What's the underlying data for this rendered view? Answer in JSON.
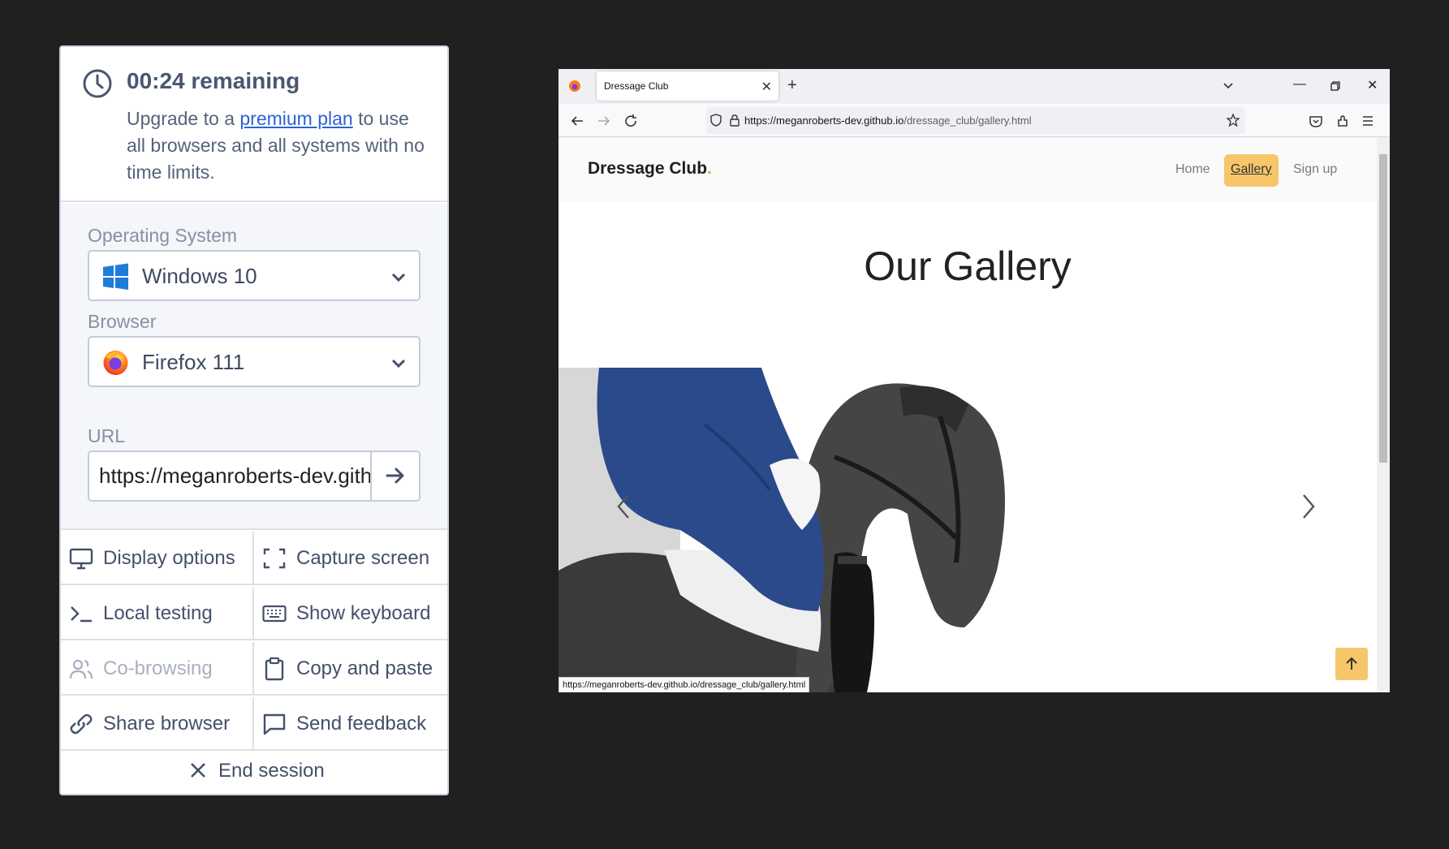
{
  "panel": {
    "timer": {
      "time": "00:24 remaining",
      "upgrade_prefix": "Upgrade to a ",
      "upgrade_link": "premium plan",
      "upgrade_suffix": " to use all browsers and all systems with no time limits."
    },
    "os": {
      "label": "Operating System",
      "value": "Windows 10",
      "icon": "windows-logo-icon"
    },
    "browser": {
      "label": "Browser",
      "value": "Firefox 111",
      "icon": "firefox-logo-icon"
    },
    "url": {
      "label": "URL",
      "value": "https://meganroberts-dev.github.io/dressage_club/gallery.html"
    },
    "actions": [
      {
        "label": "Display options",
        "icon": "monitor-icon",
        "enabled": true
      },
      {
        "label": "Capture screen",
        "icon": "capture-icon",
        "enabled": true
      },
      {
        "label": "Local testing",
        "icon": "terminal-icon",
        "enabled": true
      },
      {
        "label": "Show keyboard",
        "icon": "keyboard-icon",
        "enabled": true
      },
      {
        "label": "Co-browsing",
        "icon": "users-icon",
        "enabled": false
      },
      {
        "label": "Copy and paste",
        "icon": "clipboard-icon",
        "enabled": true
      },
      {
        "label": "Share browser",
        "icon": "link-icon",
        "enabled": true
      },
      {
        "label": "Send feedback",
        "icon": "chat-icon",
        "enabled": true
      }
    ],
    "end_session": "End session"
  },
  "browser": {
    "tab_title": "Dressage Club",
    "address_host": "https://meganroberts-dev.github.io",
    "address_path": "/dressage_club/gallery.html",
    "status_url": "https://meganroberts-dev.github.io/dressage_club/gallery.html"
  },
  "site": {
    "logo": "Dressage Club",
    "logo_dot": ".",
    "nav": [
      {
        "label": "Home",
        "active": false
      },
      {
        "label": "Gallery",
        "active": true
      },
      {
        "label": "Sign up",
        "active": false
      }
    ],
    "gallery_title": "Our Gallery"
  },
  "colors": {
    "accent": "#f7c66a",
    "link": "#2a63d8",
    "panel_text": "#44506a"
  }
}
